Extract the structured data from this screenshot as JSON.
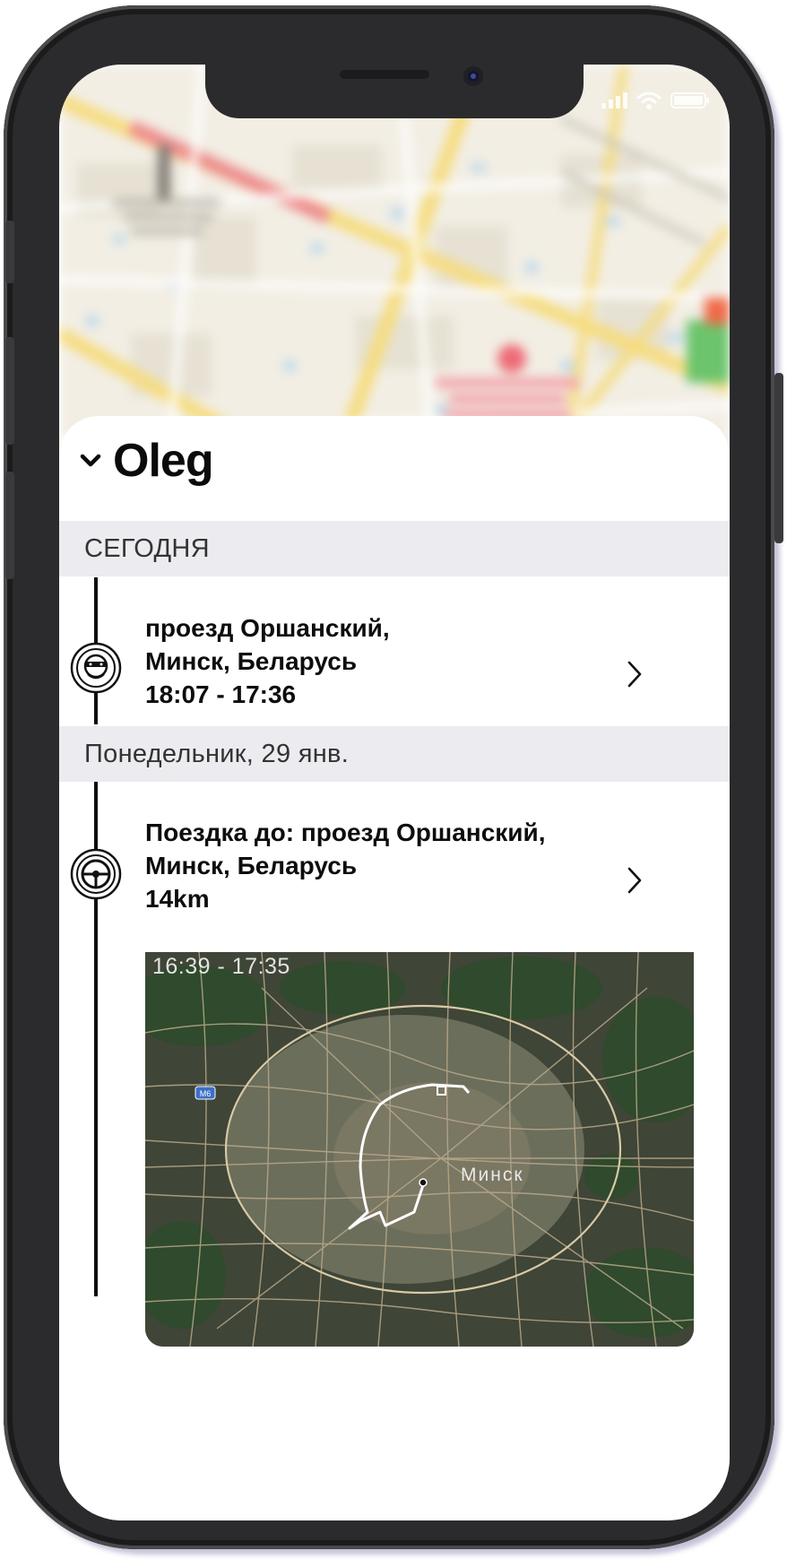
{
  "contact": {
    "name": "Oleg"
  },
  "sections": [
    {
      "label": "СЕГОДНЯ"
    },
    {
      "label": "Понедельник, 29 янв."
    }
  ],
  "events": [
    {
      "icon": "stopped-car-icon",
      "lines": [
        "проезд Оршанский,",
        "Минск, Беларусь",
        "18:07 -  17:36"
      ]
    },
    {
      "icon": "steering-wheel-icon",
      "lines": [
        "Поездка до: проезд Оршанский,",
        "Минск, Беларусь",
        "14km"
      ]
    }
  ],
  "trip_map": {
    "time_range": "16:39 - 17:35",
    "city_label": "Минск",
    "road_badge": "M6"
  },
  "colors": {
    "accent_route": "#ffffff",
    "section_bg": "#ececf0",
    "map_bg": "#3d4336"
  }
}
